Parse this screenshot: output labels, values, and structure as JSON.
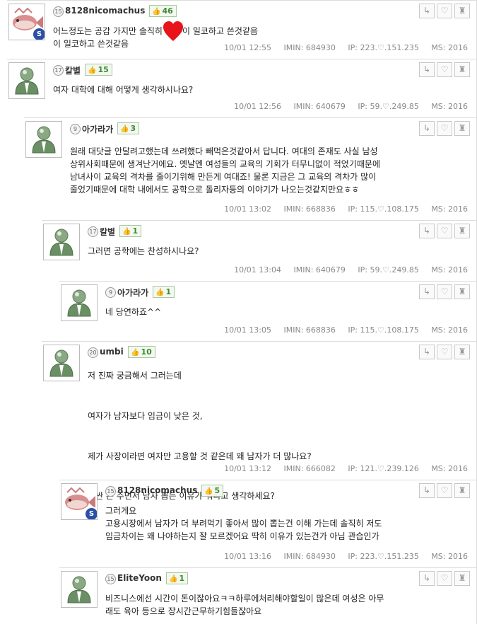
{
  "comments": [
    {
      "nick": "8128nicomachus",
      "level": "15",
      "likes": "46",
      "avatar": "fish",
      "lines": [
        "어느정도는 공감 가지만 솔직히",
        "이 일코하고 쓴것같음"
      ],
      "date": "10/01 12:55",
      "imin": "684930",
      "ip": "223.♡.151.235",
      "ms": "2016"
    },
    {
      "nick": "칼별",
      "level": "17",
      "likes": "15",
      "avatar": "person",
      "lines": [
        "여자 대학에 대해 어떻게 생각하시나요?"
      ],
      "date": "10/01 12:56",
      "imin": "640679",
      "ip": "59.♡.249.85",
      "ms": "2016"
    },
    {
      "nick": "아가라가",
      "level": "9",
      "likes": "3",
      "avatar": "person",
      "lines": [
        "원래 대닷글 안달려고했는데 쓰려했다 빼먹은것같아서 답니다. 여대의 존재도 사실 남성",
        "상위사회때문에 생겨난거에요. 옛날엔 여성들의 교육의 기회가 터무니없이 적었기때문에",
        "남녀사이 교육의 격차를 줄이기위해 만든게 여대죠! 물론 지금은 그 교육의 격차가 많이",
        "줄었기때문에 대학 내에서도 공학으로 돌리자등의 이야기가 나오는것같지만요ㅎㅎ"
      ],
      "date": "10/01 13:02",
      "imin": "668836",
      "ip": "115.♡.108.175",
      "ms": "2016"
    },
    {
      "nick": "칼별",
      "level": "17",
      "likes": "1",
      "avatar": "person",
      "lines": [
        "그러면  공학에는 찬성하시나요?"
      ],
      "date": "10/01 13:04",
      "imin": "640679",
      "ip": "59.♡.249.85",
      "ms": "2016"
    },
    {
      "nick": "아가라가",
      "level": "9",
      "likes": "1",
      "avatar": "person",
      "lines": [
        "네 당연하죠^^"
      ],
      "date": "10/01 13:05",
      "imin": "668836",
      "ip": "115.♡.108.175",
      "ms": "2016"
    },
    {
      "nick": "umbi",
      "level": "20",
      "likes": "10",
      "avatar": "person",
      "lines": [
        "저 진짜 궁금해서 그러는데",
        "",
        "여자가 남자보다 임금이 낮은 것,",
        "",
        "제가 사장이라면 여자만 고용할 것 같은데 왜 남자가 더 많나요?",
        "",
        "비싼 돈 주면서 남자 뽑는 이유가 뭐라고 생각하세요?"
      ],
      "date": "10/01 13:12",
      "imin": "666082",
      "ip": "121.♡.239.126",
      "ms": "2016"
    },
    {
      "nick": "8128nicomachus",
      "level": "15",
      "likes": "5",
      "avatar": "fish",
      "lines": [
        "그러게요",
        "고용시장에서 남자가 더 부려먹기 좋아서 많이 뽑는건 이해 가는데 솔직히 저도",
        "임금차이는 왜 나야하는지 잘 모르겠어요 딱히 이유가 있는건가 아님 관습인가"
      ],
      "date": "10/01 13:16",
      "imin": "684930",
      "ip": "223.♡.151.235",
      "ms": "2016"
    },
    {
      "nick": "EliteYoon",
      "level": "15",
      "likes": "1",
      "avatar": "person",
      "lines": [
        "비즈니스에선 시간이 돈이잖아요ㅋㅋ하루에처리해야할일이 많은데 여성은 아무",
        "래도 육아 등으로 장시간근무하기힘들잖아요"
      ],
      "date": "",
      "imin": "",
      "ip": "",
      "ms": ""
    }
  ],
  "meta_labels": {
    "imin": "IMIN:",
    "ip": "IP:",
    "ms": "MS:"
  },
  "icons": {
    "reply": "reply-arrow-icon",
    "like": "heart-outline-icon",
    "report": "siren-icon",
    "thumb": "thumbs-up-icon"
  },
  "colors": {
    "likes_green": "#3d8a2f",
    "heart_red": "#e8141a",
    "badge_blue": "#2a4fa8"
  }
}
